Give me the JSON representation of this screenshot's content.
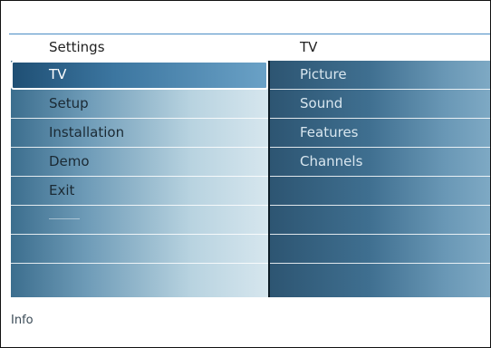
{
  "header": {
    "left_title": "Settings",
    "right_title": "TV"
  },
  "left_menu": {
    "items": [
      {
        "label": "TV",
        "selected": true
      },
      {
        "label": "Setup"
      },
      {
        "label": "Installation"
      },
      {
        "label": "Demo"
      },
      {
        "label": "Exit"
      },
      {
        "label": ""
      },
      {
        "label": ""
      },
      {
        "label": ""
      }
    ]
  },
  "right_menu": {
    "items": [
      {
        "label": "Picture"
      },
      {
        "label": "Sound"
      },
      {
        "label": "Features"
      },
      {
        "label": "Channels"
      },
      {
        "label": ""
      },
      {
        "label": ""
      },
      {
        "label": ""
      },
      {
        "label": ""
      }
    ]
  },
  "footer": {
    "info_label": "Info"
  },
  "colors": {
    "accent_line": "#4a8cc4",
    "selected_bg": "#3c76a0",
    "panel_left": "#6f9cb8",
    "panel_right": "#3f6f90"
  }
}
